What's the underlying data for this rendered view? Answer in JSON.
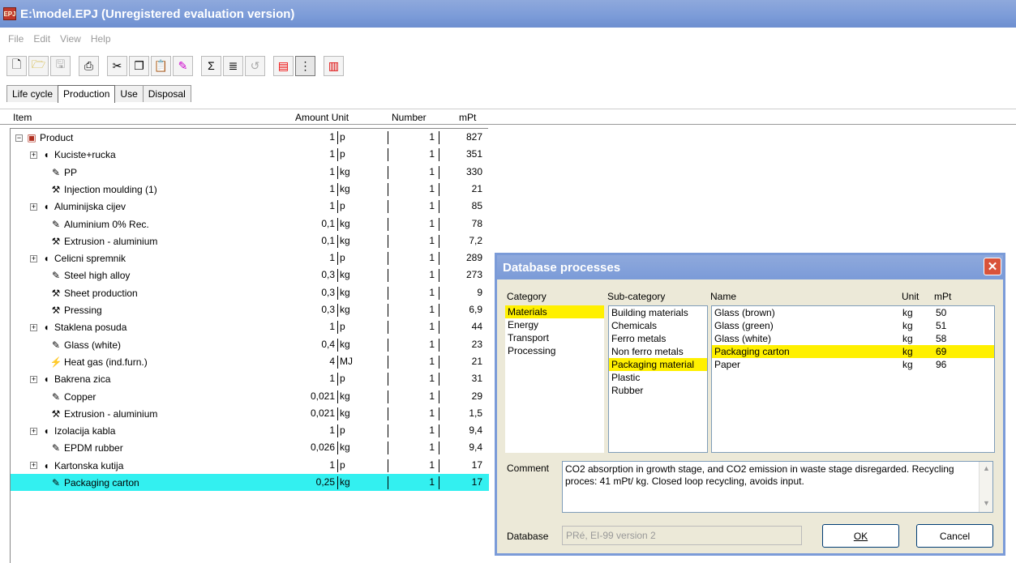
{
  "window": {
    "title": "E:\\model.EPJ (Unregistered evaluation version)",
    "icon": "app-logo-icon",
    "icon_text": "EPJ"
  },
  "menu": [
    "File",
    "Edit",
    "View",
    "Help"
  ],
  "toolbar": [
    "new-icon",
    "open-icon",
    "save-icon",
    "print-icon",
    "cut-icon",
    "copy-icon",
    "paste-icon",
    "edit-icon",
    "sigma-icon",
    "calc-icon",
    "undo-icon",
    "network-icon",
    "tree-icon",
    "chart-icon"
  ],
  "tabs": [
    "Life cycle",
    "Production",
    "Use",
    "Disposal"
  ],
  "active_tab": "Production",
  "columns": {
    "item": "Item",
    "amount_unit": "Amount Unit",
    "number": "Number",
    "mpt": "mPt"
  },
  "rows": [
    {
      "indent": 0,
      "type": "product",
      "label": "Product",
      "amount": "1",
      "unit": "p",
      "number": "1",
      "mpt": "827"
    },
    {
      "indent": 1,
      "type": "assembly",
      "label": "Kuciste+rucka",
      "amount": "1",
      "unit": "p",
      "number": "1",
      "mpt": "351"
    },
    {
      "indent": 2,
      "type": "material",
      "label": "PP",
      "amount": "1",
      "unit": "kg",
      "number": "1",
      "mpt": "330"
    },
    {
      "indent": 2,
      "type": "process",
      "label": "Injection moulding (1)",
      "amount": "1",
      "unit": "kg",
      "number": "1",
      "mpt": "21"
    },
    {
      "indent": 1,
      "type": "assembly",
      "label": "Aluminijska cijev",
      "amount": "1",
      "unit": "p",
      "number": "1",
      "mpt": "85"
    },
    {
      "indent": 2,
      "type": "material",
      "label": "Aluminium 0% Rec.",
      "amount": "0,1",
      "unit": "kg",
      "number": "1",
      "mpt": "78"
    },
    {
      "indent": 2,
      "type": "process",
      "label": "Extrusion - aluminium",
      "amount": "0,1",
      "unit": "kg",
      "number": "1",
      "mpt": "7,2"
    },
    {
      "indent": 1,
      "type": "assembly",
      "label": "Celicni spremnik",
      "amount": "1",
      "unit": "p",
      "number": "1",
      "mpt": "289"
    },
    {
      "indent": 2,
      "type": "material",
      "label": "Steel high alloy",
      "amount": "0,3",
      "unit": "kg",
      "number": "1",
      "mpt": "273"
    },
    {
      "indent": 2,
      "type": "process",
      "label": "Sheet production",
      "amount": "0,3",
      "unit": "kg",
      "number": "1",
      "mpt": "9"
    },
    {
      "indent": 2,
      "type": "process",
      "label": "Pressing",
      "amount": "0,3",
      "unit": "kg",
      "number": "1",
      "mpt": "6,9"
    },
    {
      "indent": 1,
      "type": "assembly",
      "label": "Staklena posuda",
      "amount": "1",
      "unit": "p",
      "number": "1",
      "mpt": "44"
    },
    {
      "indent": 2,
      "type": "material",
      "label": "Glass (white)",
      "amount": "0,4",
      "unit": "kg",
      "number": "1",
      "mpt": "23"
    },
    {
      "indent": 2,
      "type": "energy",
      "label": "Heat gas (ind.furn.)",
      "amount": "4",
      "unit": "MJ",
      "number": "1",
      "mpt": "21"
    },
    {
      "indent": 1,
      "type": "assembly",
      "label": "Bakrena zica",
      "amount": "1",
      "unit": "p",
      "number": "1",
      "mpt": "31"
    },
    {
      "indent": 2,
      "type": "material",
      "label": "Copper",
      "amount": "0,021",
      "unit": "kg",
      "number": "1",
      "mpt": "29"
    },
    {
      "indent": 2,
      "type": "process",
      "label": "Extrusion - aluminium",
      "amount": "0,021",
      "unit": "kg",
      "number": "1",
      "mpt": "1,5"
    },
    {
      "indent": 1,
      "type": "assembly",
      "label": "Izolacija kabla",
      "amount": "1",
      "unit": "p",
      "number": "1",
      "mpt": "9,4"
    },
    {
      "indent": 2,
      "type": "material",
      "label": "EPDM rubber",
      "amount": "0,026",
      "unit": "kg",
      "number": "1",
      "mpt": "9,4"
    },
    {
      "indent": 1,
      "type": "assembly",
      "label": "Kartonska kutija",
      "amount": "1",
      "unit": "p",
      "number": "1",
      "mpt": "17"
    },
    {
      "indent": 2,
      "type": "material",
      "label": "Packaging carton",
      "amount": "0,25",
      "unit": "kg",
      "number": "1",
      "mpt": "17",
      "selected": true
    }
  ],
  "dialog": {
    "title": "Database processes",
    "category_label": "Category",
    "subcategory_label": "Sub-category",
    "name_label": "Name",
    "unit_label": "Unit",
    "mpt_label": "mPt",
    "categories": [
      "Materials",
      "Energy",
      "Transport",
      "Processing"
    ],
    "selected_category": "Materials",
    "subcategories": [
      "Building materials",
      "Chemicals",
      "Ferro metals",
      "Non ferro metals",
      "Packaging material",
      "Plastic",
      "Rubber"
    ],
    "selected_subcategory": "Packaging material",
    "processes": [
      {
        "name": "Glass (brown)",
        "unit": "kg",
        "mpt": "50"
      },
      {
        "name": "Glass (green)",
        "unit": "kg",
        "mpt": "51"
      },
      {
        "name": "Glass (white)",
        "unit": "kg",
        "mpt": "58"
      },
      {
        "name": "Packaging carton",
        "unit": "kg",
        "mpt": "69",
        "selected": true
      },
      {
        "name": "Paper",
        "unit": "kg",
        "mpt": "96"
      }
    ],
    "comment_label": "Comment",
    "comment_text": "CO2 absorption in growth stage, and CO2 emission in waste stage disregarded. Recycling proces: 41 mPt/ kg. Closed loop recycling, avoids input.",
    "database_label": "Database",
    "database_value": "PRé, EI-99 version 2",
    "ok_label": "OK",
    "cancel_label": "Cancel"
  },
  "colors": {
    "title_bar": "#7b9bd8",
    "selection_cyan": "#33f0f0",
    "selection_yellow": "#fff000",
    "close_button": "#d9533a"
  }
}
